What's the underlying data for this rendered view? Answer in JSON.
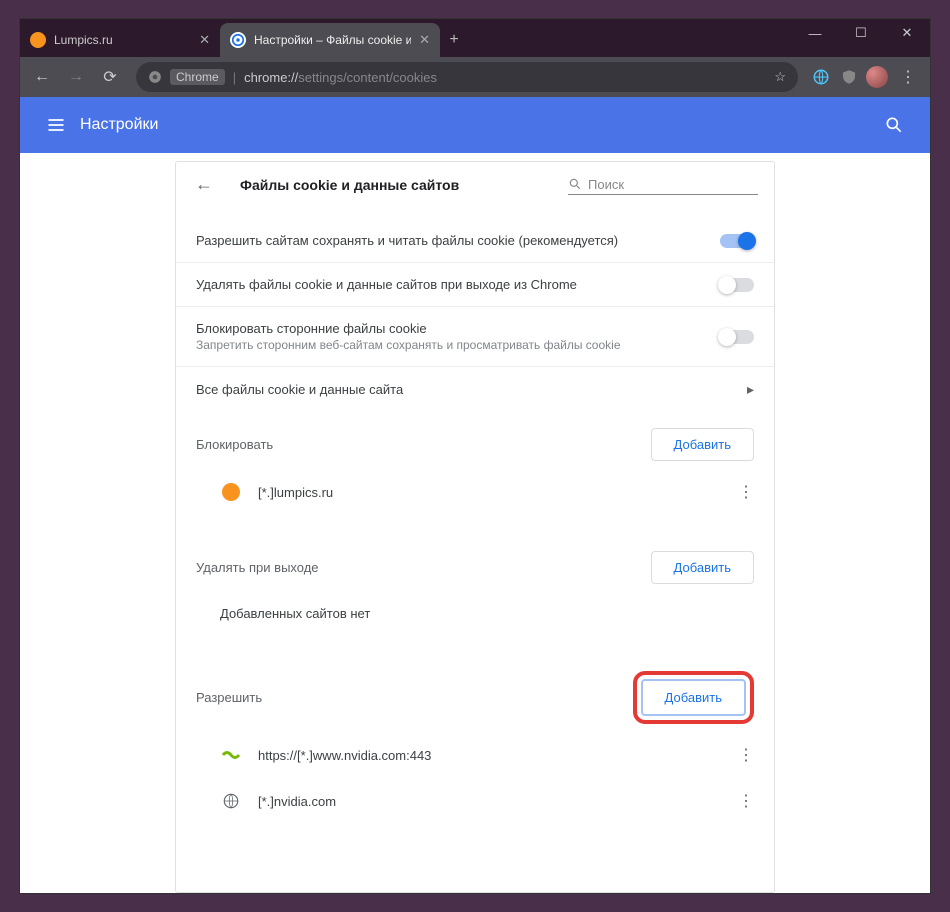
{
  "window": {
    "minimize": "—",
    "maximize": "☐",
    "close": "✕"
  },
  "tabs": [
    {
      "title": "Lumpics.ru",
      "favicon_color": "#f7931e",
      "active": false
    },
    {
      "title": "Настройки – Файлы cookie и да",
      "favicon_color": "#1a73e8",
      "active": true
    }
  ],
  "toolbar": {
    "chrome_chip": "Chrome",
    "url_host": "chrome://",
    "url_path": "settings/content/cookies"
  },
  "appbar": {
    "title": "Настройки"
  },
  "card": {
    "title": "Файлы cookie и данные сайтов",
    "search_placeholder": "Поиск"
  },
  "rows": {
    "allow_cookies": {
      "label": "Разрешить сайтам сохранять и читать файлы cookie (рекомендуется)",
      "on": true
    },
    "clear_on_exit": {
      "label": "Удалять файлы cookie и данные сайтов при выходе из Chrome",
      "on": false
    },
    "block_third": {
      "label": "Блокировать сторонние файлы cookie",
      "sub": "Запретить сторонним веб-сайтам сохранять и просматривать файлы cookie",
      "on": false
    },
    "all_data": {
      "label": "Все файлы cookie и данные сайта"
    }
  },
  "sections": {
    "block": {
      "title": "Блокировать",
      "add": "Добавить",
      "sites": [
        {
          "icon": "orange",
          "label": "[*.]lumpics.ru"
        }
      ]
    },
    "clear": {
      "title": "Удалять при выходе",
      "add": "Добавить",
      "empty": "Добавленных сайтов нет"
    },
    "allow": {
      "title": "Разрешить",
      "add": "Добавить",
      "sites": [
        {
          "icon": "nvidia",
          "label": "https://[*.]www.nvidia.com:443"
        },
        {
          "icon": "globe",
          "label": "[*.]nvidia.com"
        }
      ]
    }
  }
}
